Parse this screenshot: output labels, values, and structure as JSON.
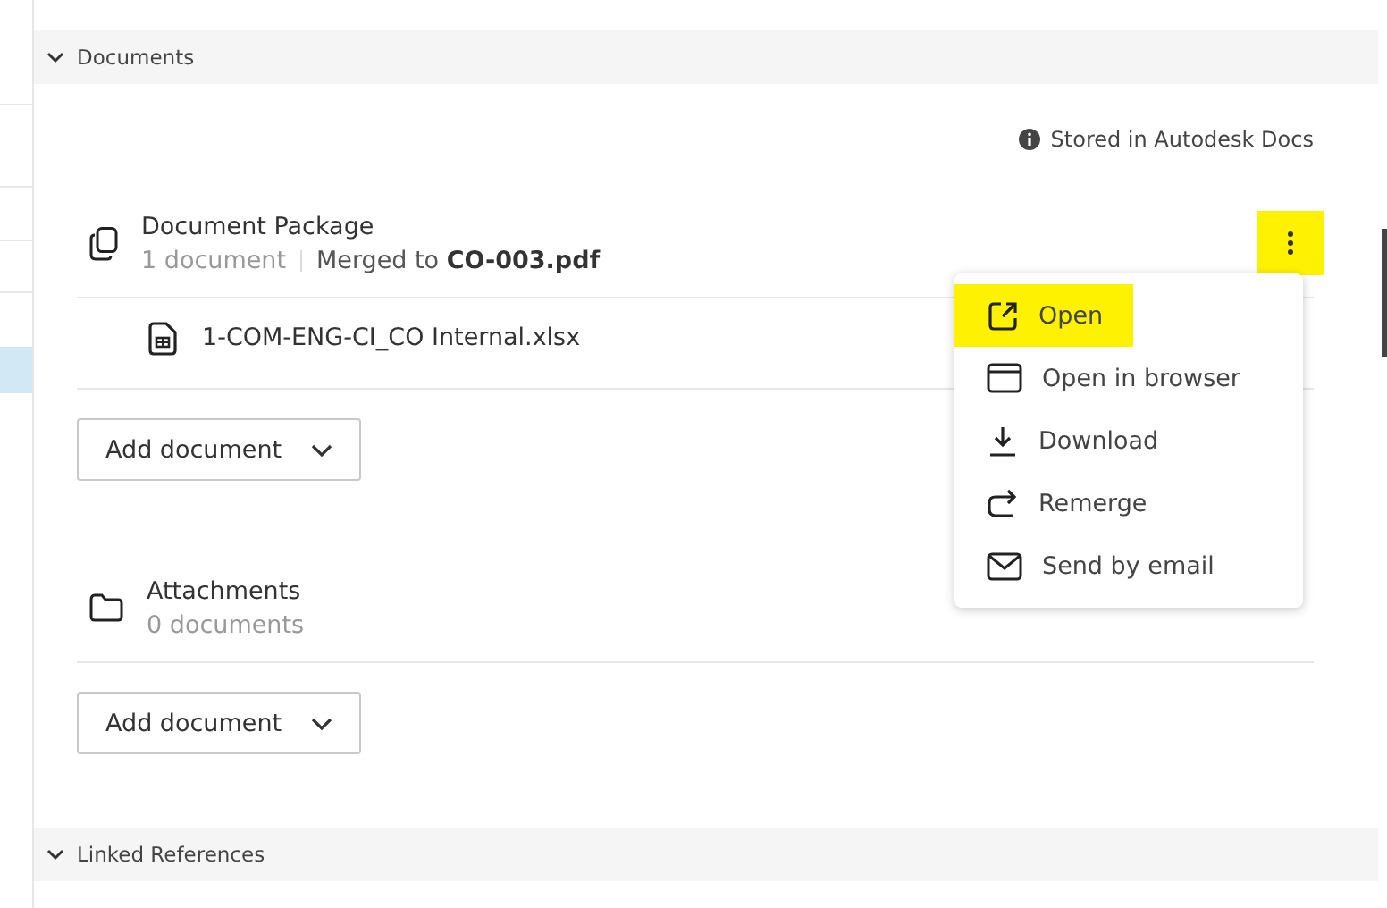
{
  "sections": [
    {
      "title": "Documents",
      "expanded": true
    },
    {
      "title": "Linked References",
      "expanded": true
    }
  ],
  "storage_note": "Stored in Autodesk Docs",
  "groups": [
    {
      "kind": "package",
      "title": "Document Package",
      "count": "1 document",
      "merged_prefix": "Merged to ",
      "merged_file": "CO-003.pdf",
      "more_highlighted": true,
      "files": [
        {
          "name": "1-COM-ENG-CI_CO Internal.xlsx"
        }
      ],
      "add_button": "Add document"
    },
    {
      "kind": "folder",
      "title": "Attachments",
      "count": "0 documents",
      "add_button": "Add document"
    }
  ],
  "menu": [
    {
      "kind": "open",
      "label": "Open",
      "highlighted": true
    },
    {
      "kind": "browser",
      "label": "Open in browser",
      "highlighted": false
    },
    {
      "kind": "download",
      "label": "Download",
      "highlighted": false
    },
    {
      "kind": "remerge",
      "label": "Remerge",
      "highlighted": false
    },
    {
      "kind": "email",
      "label": "Send by email",
      "highlighted": false
    }
  ]
}
